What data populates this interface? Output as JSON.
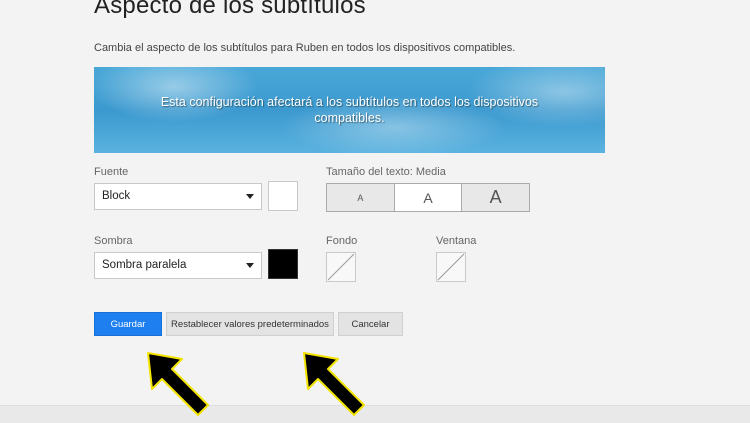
{
  "header": {
    "title": "Aspecto de los subtítulos",
    "description": "Cambia el aspecto de los subtítulos para Ruben en todos los dispositivos compatibles."
  },
  "preview": {
    "text": "Esta configuración afectará a los subtítulos en todos los dispositivos compatibles."
  },
  "font": {
    "label": "Fuente",
    "value": "Block",
    "color": "#ffffff"
  },
  "text_size": {
    "label": "Tamaño del texto: Media",
    "options": [
      "A",
      "A",
      "A"
    ],
    "selected": "Media"
  },
  "shadow": {
    "label": "Sombra",
    "value": "Sombra paralela",
    "color": "#000000"
  },
  "background": {
    "label": "Fondo",
    "value": "none"
  },
  "window": {
    "label": "Ventana",
    "value": "none"
  },
  "actions": {
    "save": "Guardar",
    "reset": "Restablecer valores predeterminados",
    "cancel": "Cancelar"
  },
  "annotations": {
    "arrow_color": "#000000",
    "arrow_outline": "#f2e400"
  }
}
